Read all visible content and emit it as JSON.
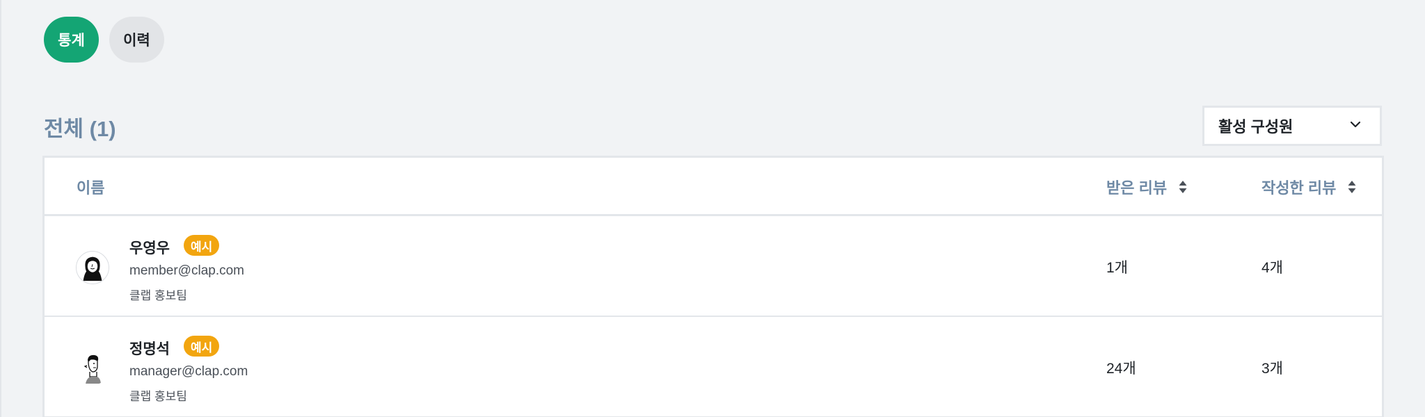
{
  "tabs": [
    {
      "label": "통계",
      "active": true
    },
    {
      "label": "이력",
      "active": false
    }
  ],
  "summary": {
    "title": "전체 (1)"
  },
  "filter": {
    "selected": "활성 구성원"
  },
  "table": {
    "columns": {
      "name": "이름",
      "received": "받은 리뷰",
      "written": "작성한 리뷰"
    },
    "rows": [
      {
        "name": "우영우",
        "badge": "예시",
        "email": "member@clap.com",
        "team": "클랩 홍보팀",
        "received": "1개",
        "written": "4개",
        "avatar_icon": "woman-illustration-avatar"
      },
      {
        "name": "정명석",
        "badge": "예시",
        "email": "manager@clap.com",
        "team": "클랩 홍보팀",
        "received": "24개",
        "written": "3개",
        "avatar_icon": "man-illustration-avatar"
      }
    ]
  },
  "colors": {
    "accent": "#14a574",
    "badge": "#f2a50f",
    "muted_heading": "#6e89a5"
  }
}
